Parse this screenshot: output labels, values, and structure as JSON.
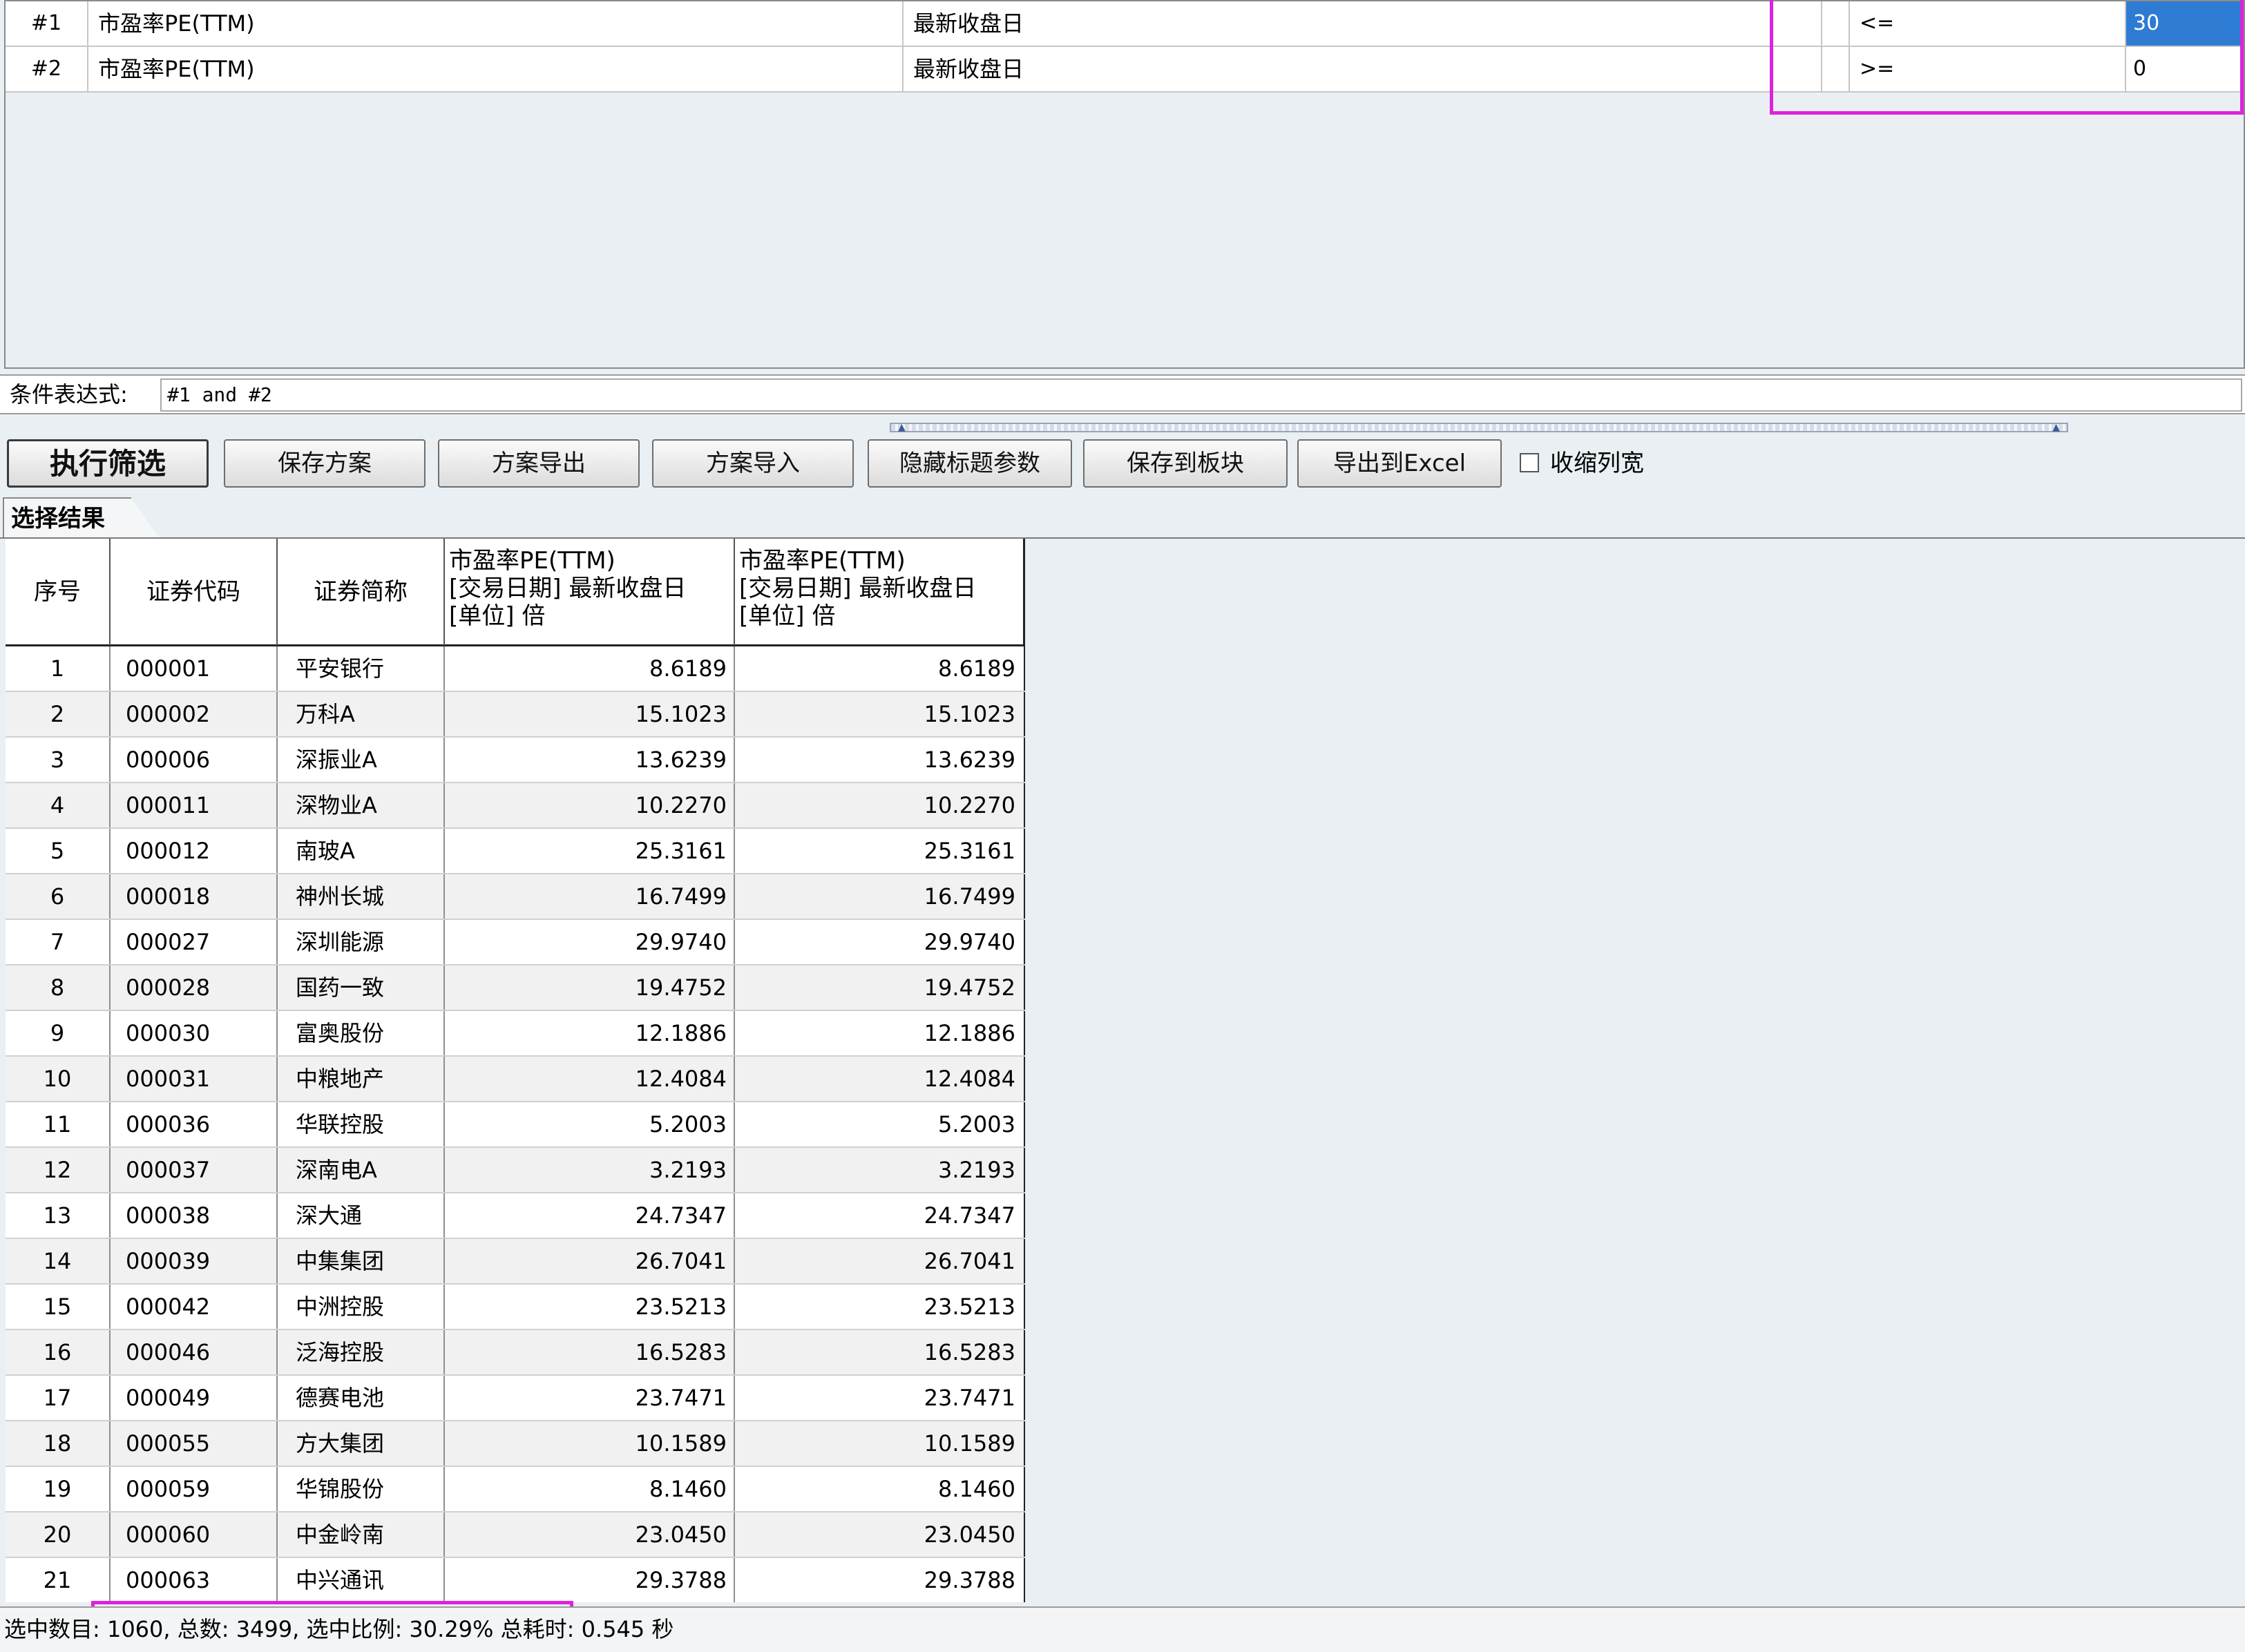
{
  "conditions": [
    {
      "idx": "#1",
      "indicator": "市盈率PE(TTM)",
      "date": "最新收盘日",
      "op": "<=",
      "value": "30",
      "selected": true
    },
    {
      "idx": "#2",
      "indicator": "市盈率PE(TTM)",
      "date": "最新收盘日",
      "op": ">=",
      "value": "0",
      "selected": false
    }
  ],
  "expression": {
    "label": "条件表达式:",
    "value": "#1 and #2"
  },
  "toolbar": {
    "run": "执行筛选",
    "save_plan": "保存方案",
    "export_plan": "方案导出",
    "import_plan": "方案导入",
    "hide_title_params": "隐藏标题参数",
    "save_to_block": "保存到板块",
    "export_excel": "导出到Excel",
    "compress_cols": "收缩列宽"
  },
  "result_tab": "选择结果",
  "table": {
    "headers": {
      "seq": "序号",
      "code": "证券代码",
      "name": "证券简称",
      "v1": [
        "市盈率PE(TTM)",
        "[交易日期] 最新收盘日",
        "[单位] 倍"
      ],
      "v2": [
        "市盈率PE(TTM)",
        "[交易日期] 最新收盘日",
        "[单位] 倍"
      ]
    },
    "rows": [
      {
        "seq": "1",
        "code": "000001",
        "name": "平安银行",
        "v1": "8.6189",
        "v2": "8.6189"
      },
      {
        "seq": "2",
        "code": "000002",
        "name": "万科A",
        "v1": "15.1023",
        "v2": "15.1023"
      },
      {
        "seq": "3",
        "code": "000006",
        "name": "深振业A",
        "v1": "13.6239",
        "v2": "13.6239"
      },
      {
        "seq": "4",
        "code": "000011",
        "name": "深物业A",
        "v1": "10.2270",
        "v2": "10.2270"
      },
      {
        "seq": "5",
        "code": "000012",
        "name": "南玻A",
        "v1": "25.3161",
        "v2": "25.3161"
      },
      {
        "seq": "6",
        "code": "000018",
        "name": "神州长城",
        "v1": "16.7499",
        "v2": "16.7499"
      },
      {
        "seq": "7",
        "code": "000027",
        "name": "深圳能源",
        "v1": "29.9740",
        "v2": "29.9740"
      },
      {
        "seq": "8",
        "code": "000028",
        "name": "国药一致",
        "v1": "19.4752",
        "v2": "19.4752"
      },
      {
        "seq": "9",
        "code": "000030",
        "name": "富奥股份",
        "v1": "12.1886",
        "v2": "12.1886"
      },
      {
        "seq": "10",
        "code": "000031",
        "name": "中粮地产",
        "v1": "12.4084",
        "v2": "12.4084"
      },
      {
        "seq": "11",
        "code": "000036",
        "name": "华联控股",
        "v1": "5.2003",
        "v2": "5.2003"
      },
      {
        "seq": "12",
        "code": "000037",
        "name": "深南电A",
        "v1": "3.2193",
        "v2": "3.2193"
      },
      {
        "seq": "13",
        "code": "000038",
        "name": "深大通",
        "v1": "24.7347",
        "v2": "24.7347"
      },
      {
        "seq": "14",
        "code": "000039",
        "name": "中集集团",
        "v1": "26.7041",
        "v2": "26.7041"
      },
      {
        "seq": "15",
        "code": "000042",
        "name": "中洲控股",
        "v1": "23.5213",
        "v2": "23.5213"
      },
      {
        "seq": "16",
        "code": "000046",
        "name": "泛海控股",
        "v1": "16.5283",
        "v2": "16.5283"
      },
      {
        "seq": "17",
        "code": "000049",
        "name": "德赛电池",
        "v1": "23.7471",
        "v2": "23.7471"
      },
      {
        "seq": "18",
        "code": "000055",
        "name": "方大集团",
        "v1": "10.1589",
        "v2": "10.1589"
      },
      {
        "seq": "19",
        "code": "000059",
        "name": "华锦股份",
        "v1": "8.1460",
        "v2": "8.1460"
      },
      {
        "seq": "20",
        "code": "000060",
        "name": "中金岭南",
        "v1": "23.0450",
        "v2": "23.0450"
      },
      {
        "seq": "21",
        "code": "000063",
        "name": "中兴通讯",
        "v1": "29.3788",
        "v2": "29.3788"
      }
    ]
  },
  "status": "选中数目: 1060, 总数: 3499, 选中比例: 30.29% 总耗时: 0.545 秒",
  "colors": {
    "highlight": "#dd22dd",
    "selection": "#2e7bd4"
  }
}
